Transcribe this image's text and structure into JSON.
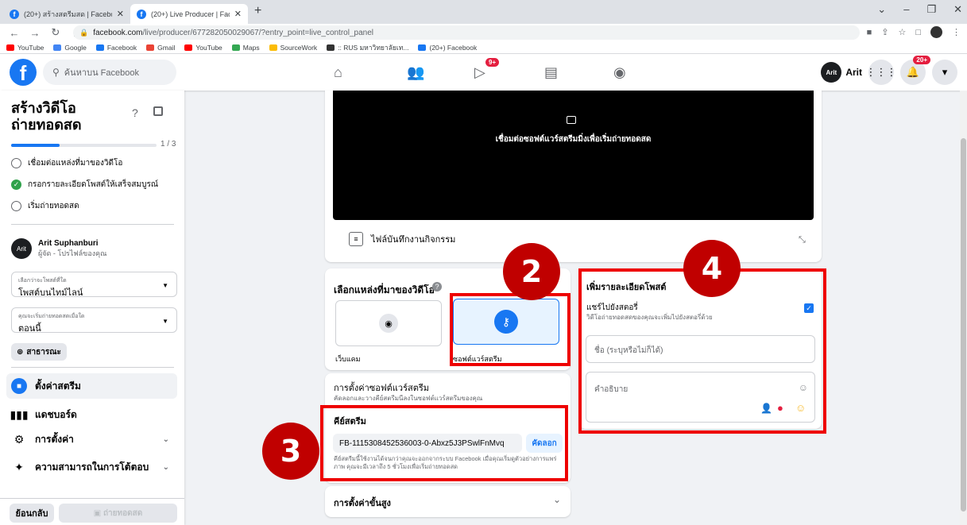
{
  "browser": {
    "tabs": [
      {
        "title": "(20+) สร้างสตรีมสด | Facebook"
      },
      {
        "title": "(20+) Live Producer | Facebook"
      }
    ],
    "new_tab": "+",
    "url_host": "facebook.com",
    "url_path": "/live/producer/677282050029067/?entry_point=live_control_panel",
    "bookmarks": [
      {
        "label": "YouTube",
        "color": "#ff0000"
      },
      {
        "label": "Google",
        "color": "#4285f4"
      },
      {
        "label": "Facebook",
        "color": "#1877f2"
      },
      {
        "label": "Gmail",
        "color": "#ea4335"
      },
      {
        "label": "YouTube",
        "color": "#ff0000"
      },
      {
        "label": "Maps",
        "color": "#34a853"
      },
      {
        "label": "SourceWork",
        "color": "#fbbc04"
      },
      {
        "label": ":: RUS มหาวิทยาลัยเท...",
        "color": "#333333"
      },
      {
        "label": "(20+) Facebook",
        "color": "#1877f2"
      }
    ]
  },
  "fb": {
    "search_placeholder": "ค้นหาบน Facebook",
    "watch_badge": "9+",
    "notif_badge": "20+",
    "user_name": "Arit",
    "avatar_text": "Arit"
  },
  "sidebar": {
    "title": "สร้างวิดีโอถ่ายทอดสด",
    "progress_label": "1 / 3",
    "progress_fraction": 0.333,
    "steps": [
      {
        "label": "เชื่อมต่อแหล่งที่มาของวิดีโอ",
        "done": false
      },
      {
        "label": "กรอกรายละเอียดโพสต์ให้เสร็จสมบูรณ์",
        "done": true
      },
      {
        "label": "เริ่มถ่ายทอดสด",
        "done": false
      }
    ],
    "host_name": "Arit Suphanburi",
    "host_role": "ผู้จัด - โปรไฟล์ของคุณ",
    "post_where_label": "เลือกว่าจะโพสต์ที่ใด",
    "post_where_value": "โพสต์บนไทม์ไลน์",
    "when_label": "คุณจะเริ่มถ่ายทอดสดเมื่อใด",
    "when_value": "ตอนนี้",
    "audience": "สาธารณะ",
    "menu": [
      {
        "label": "ตั้งค่าสตรีม"
      },
      {
        "label": "แดชบอร์ด"
      },
      {
        "label": "การตั้งค่า"
      },
      {
        "label": "ความสามารถในการโต้ตอบ"
      }
    ],
    "back_label": "ย้อนกลับ",
    "go_live_label": "ถ่ายทอดสด"
  },
  "main": {
    "video_message": "เชื่อมต่อซอฟต์แวร์สตรีมมิ่งเพื่อเริ่มถ่ายทอดสด",
    "activity_label": "ไฟล์บันทึกงานกิจกรรม",
    "source_title": "เลือกแหล่งที่มาของวิดีโอ",
    "source_webcam": "เว็บแคม",
    "source_software": "ซอฟต์แวร์สตรีม",
    "software_settings_title": "การตั้งค่าซอฟต์แวร์สตรีม",
    "software_settings_sub": "คัดลอกและวางคีย์สตรีมนี้ลงในซอฟต์แวร์สตรีมของคุณ",
    "stream_key_title": "คีย์สตรีม",
    "stream_key_value": "FB-1115308452536003-0-Abxz5J3PSwlFnMvq",
    "copy_label": "คัดลอก",
    "stream_key_note": "คีย์สตรีมนี้ใช้งานได้จนกว่าคุณจะออกจากระบบ Facebook เมื่อคุณเริ่มดูตัวอย่างการแพร่ภาพ คุณจะมีเวลาถึง 5 ชั่วโมงเพื่อเริ่มถ่ายทอดสด",
    "advanced_label": "การตั้งค่าขั้นสูง",
    "details_title": "เพิ่มรายละเอียดโพสต์",
    "share_story_label": "แชร์ไปยังสตอรี่",
    "share_story_sub": "วิดีโอถ่ายทอดสดของคุณจะเพิ่มไปยังสตอรี่ด้วย",
    "title_placeholder": "ชื่อ (ระบุหรือไม่ก็ได้)",
    "desc_placeholder": "คำอธิบาย"
  },
  "annotations": [
    "2",
    "3",
    "4"
  ]
}
